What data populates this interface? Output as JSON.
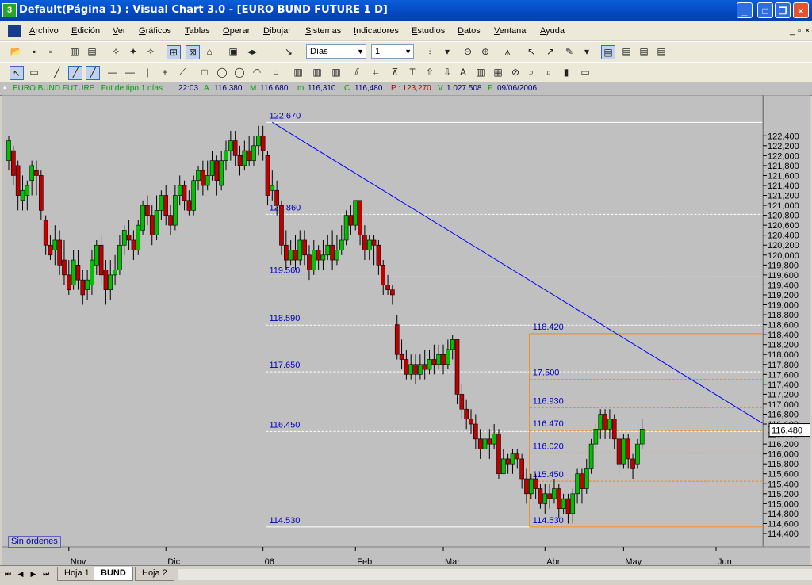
{
  "window": {
    "title": "Default(Página 1) : Visual Chart  3.0 - [EURO BUND FUTURE 1 D]",
    "app_icon": "3",
    "minimize": "_",
    "maximize": "□",
    "close": "×"
  },
  "menu": {
    "items": [
      "Archivo",
      "Edición",
      "Ver",
      "Gráficos",
      "Tablas",
      "Operar",
      "Dibujar",
      "Sistemas",
      "Indicadores",
      "Estudios",
      "Datos",
      "Ventana",
      "Ayuda"
    ],
    "mdi_controls": [
      "_",
      "▫",
      "×"
    ]
  },
  "toolbar": {
    "period_select": "Días",
    "interval_select": "1"
  },
  "infobar": {
    "symbol": "EURO BUND FUTURE : Fut de tipo 1 días",
    "time": "22:03",
    "open_label": "A",
    "open": "116,380",
    "high_label": "M",
    "high": "116,680",
    "low_label": "m",
    "low": "116,310",
    "close_label": "C",
    "close": "116,480",
    "change_label": "P",
    "change": ": 123,270",
    "volume_label": "V",
    "volume": "1.027.508",
    "date_label": "F",
    "date": "09/06/2006"
  },
  "status": {
    "orders": "Sin órdenes"
  },
  "tabs": [
    "Hoja 1",
    "BUND",
    "Hoja 2"
  ],
  "active_tab": "BUND",
  "colors": {
    "chart_bg": "#c0c0c0",
    "up": "#00c000",
    "down": "#c00000",
    "trendline": "#0000ff",
    "fib_left": "#ffffff",
    "fib_right": "#ff8000",
    "label_text": "#0000c0"
  },
  "chart_data": {
    "type": "candlestick",
    "ylim": [
      114.4,
      122.5
    ],
    "y_ticks": [
      "122,400",
      "122,200",
      "122,000",
      "121,800",
      "121,600",
      "121,400",
      "121,200",
      "121,000",
      "120,800",
      "120,600",
      "120,400",
      "120,200",
      "120,000",
      "119,800",
      "119,600",
      "119,400",
      "119,200",
      "119,000",
      "118,800",
      "118,600",
      "118,400",
      "118,200",
      "118,000",
      "117,800",
      "117,600",
      "117,400",
      "117,200",
      "117,000",
      "116,800",
      "116,600",
      "116,400",
      "116,200",
      "116,000",
      "115,800",
      "115,600",
      "115,400",
      "115,200",
      "115,000",
      "114,800",
      "114,600",
      "114,400"
    ],
    "x_labels": [
      {
        "label": "Nov",
        "index": 13
      },
      {
        "label": "Dic",
        "index": 34
      },
      {
        "label": "06",
        "index": 55
      },
      {
        "label": "Feb",
        "index": 75
      },
      {
        "label": "Mar",
        "index": 94
      },
      {
        "label": "Abr",
        "index": 116
      },
      {
        "label": "May",
        "index": 133
      },
      {
        "label": "Jun",
        "index": 153
      }
    ],
    "last_price": "116,480",
    "last_value": 116.48,
    "candles": [
      [
        121.9,
        122.3,
        122.4,
        121.7
      ],
      [
        122.1,
        121.6,
        122.2,
        121.4
      ],
      [
        121.8,
        121.2,
        121.9,
        120.9
      ],
      [
        121.1,
        121.3,
        121.6,
        120.9
      ],
      [
        121.2,
        121.4,
        121.5,
        120.9
      ],
      [
        121.5,
        121.8,
        121.9,
        121.2
      ],
      [
        121.7,
        121.6,
        121.9,
        121.2
      ],
      [
        121.6,
        120.9,
        121.7,
        120.7
      ],
      [
        120.7,
        120.2,
        120.8,
        120.0
      ],
      [
        120.2,
        120.0,
        120.4,
        119.9
      ],
      [
        120.1,
        120.3,
        120.6,
        119.8
      ],
      [
        120.3,
        119.8,
        120.5,
        119.6
      ],
      [
        119.9,
        119.6,
        120.3,
        119.4
      ],
      [
        119.6,
        119.3,
        119.9,
        119.2
      ],
      [
        119.4,
        119.9,
        120.1,
        119.3
      ],
      [
        119.8,
        119.5,
        120.1,
        119.3
      ],
      [
        119.5,
        119.2,
        119.7,
        119.0
      ],
      [
        119.3,
        119.5,
        119.7,
        119.1
      ],
      [
        119.4,
        119.9,
        120.1,
        119.2
      ],
      [
        119.8,
        120.2,
        120.3,
        119.6
      ],
      [
        120.2,
        119.6,
        120.4,
        119.4
      ],
      [
        119.7,
        119.3,
        119.9,
        119.0
      ],
      [
        119.3,
        119.6,
        119.9,
        119.1
      ],
      [
        119.6,
        119.7,
        120.0,
        119.4
      ],
      [
        119.7,
        120.2,
        120.4,
        119.6
      ],
      [
        120.2,
        120.5,
        120.6,
        120.0
      ],
      [
        120.4,
        120.3,
        120.7,
        120.1
      ],
      [
        120.3,
        120.1,
        120.5,
        119.9
      ],
      [
        120.1,
        120.6,
        120.7,
        120.0
      ],
      [
        120.5,
        121.0,
        121.1,
        120.4
      ],
      [
        121.0,
        120.8,
        121.2,
        120.6
      ],
      [
        120.8,
        120.4,
        121.0,
        120.2
      ],
      [
        120.4,
        120.9,
        121.2,
        120.3
      ],
      [
        120.9,
        121.2,
        121.3,
        120.7
      ],
      [
        121.2,
        120.8,
        121.4,
        120.6
      ],
      [
        120.8,
        120.6,
        121.0,
        120.4
      ],
      [
        120.6,
        121.2,
        121.4,
        120.5
      ],
      [
        121.2,
        121.4,
        121.6,
        121.0
      ],
      [
        121.4,
        121.1,
        121.5,
        120.9
      ],
      [
        121.1,
        120.9,
        121.3,
        120.8
      ],
      [
        120.9,
        121.5,
        121.6,
        120.8
      ],
      [
        121.5,
        121.7,
        121.8,
        121.3
      ],
      [
        121.7,
        121.4,
        121.9,
        121.2
      ],
      [
        121.4,
        121.6,
        121.9,
        121.3
      ],
      [
        121.6,
        121.9,
        122.1,
        121.5
      ],
      [
        121.9,
        121.5,
        122.0,
        121.2
      ],
      [
        121.4,
        121.9,
        122.1,
        121.3
      ],
      [
        121.9,
        122.1,
        122.3,
        121.7
      ],
      [
        122.1,
        122.3,
        122.5,
        121.9
      ],
      [
        122.3,
        122.0,
        122.5,
        121.8
      ],
      [
        122.0,
        121.8,
        122.2,
        121.6
      ],
      [
        121.8,
        122.1,
        122.3,
        121.7
      ],
      [
        122.1,
        121.9,
        122.4,
        121.8
      ],
      [
        121.9,
        122.2,
        122.4,
        121.8
      ],
      [
        122.2,
        122.4,
        122.6,
        122.0
      ],
      [
        122.4,
        122.1,
        122.6,
        121.9
      ],
      [
        122.0,
        121.2,
        122.1,
        121.0
      ],
      [
        121.3,
        121.4,
        121.7,
        121.1
      ],
      [
        121.3,
        121.0,
        121.5,
        120.8
      ],
      [
        121.0,
        120.2,
        121.1,
        120.0
      ],
      [
        120.2,
        119.9,
        120.5,
        119.7
      ],
      [
        119.9,
        120.1,
        120.3,
        119.8
      ],
      [
        120.1,
        119.9,
        120.4,
        119.7
      ],
      [
        119.9,
        120.3,
        120.5,
        119.8
      ],
      [
        120.3,
        120.0,
        120.5,
        119.8
      ],
      [
        120.0,
        119.7,
        120.2,
        119.5
      ],
      [
        119.7,
        120.1,
        120.3,
        119.6
      ],
      [
        120.1,
        119.9,
        120.2,
        119.7
      ],
      [
        119.9,
        120.0,
        120.3,
        119.7
      ],
      [
        120.0,
        120.2,
        120.4,
        119.9
      ],
      [
        120.2,
        119.9,
        120.5,
        119.7
      ],
      [
        119.9,
        120.1,
        120.4,
        119.8
      ],
      [
        120.1,
        120.3,
        120.6,
        120.0
      ],
      [
        120.3,
        120.8,
        120.9,
        120.2
      ],
      [
        120.8,
        120.6,
        121.0,
        120.4
      ],
      [
        120.6,
        121.1,
        121.1,
        120.5
      ],
      [
        121.1,
        120.4,
        121.1,
        120.2
      ],
      [
        120.4,
        120.1,
        120.6,
        119.9
      ],
      [
        120.1,
        120.3,
        120.4,
        119.9
      ],
      [
        120.3,
        120.2,
        120.4,
        119.8
      ],
      [
        120.2,
        119.8,
        120.3,
        119.6
      ],
      [
        119.8,
        119.4,
        119.9,
        119.2
      ],
      [
        119.4,
        119.3,
        119.6,
        119.2
      ],
      [
        119.3,
        119.2,
        119.4,
        119.0
      ],
      [
        118.6,
        118.0,
        118.8,
        117.9
      ],
      [
        118.0,
        117.9,
        118.3,
        117.7
      ],
      [
        117.9,
        117.6,
        118.1,
        117.5
      ],
      [
        117.6,
        117.8,
        118.0,
        117.5
      ],
      [
        117.8,
        117.6,
        118.0,
        117.4
      ],
      [
        117.6,
        117.8,
        118.0,
        117.5
      ],
      [
        117.8,
        117.7,
        118.1,
        117.5
      ],
      [
        117.7,
        117.9,
        118.1,
        117.6
      ],
      [
        117.9,
        117.8,
        118.2,
        117.6
      ],
      [
        117.8,
        118.0,
        118.2,
        117.7
      ],
      [
        118.0,
        117.8,
        118.2,
        117.6
      ],
      [
        117.8,
        118.1,
        118.3,
        117.7
      ],
      [
        118.1,
        118.3,
        118.4,
        117.9
      ],
      [
        118.3,
        117.2,
        118.3,
        117.0
      ],
      [
        117.2,
        116.9,
        117.4,
        116.7
      ],
      [
        116.9,
        116.7,
        117.1,
        116.5
      ],
      [
        116.7,
        116.6,
        116.9,
        116.4
      ],
      [
        116.6,
        116.3,
        116.8,
        116.1
      ],
      [
        116.3,
        116.1,
        116.5,
        115.9
      ],
      [
        116.1,
        116.3,
        116.5,
        116.0
      ],
      [
        116.3,
        116.2,
        116.5,
        115.9
      ],
      [
        116.2,
        116.4,
        116.6,
        116.1
      ],
      [
        116.4,
        115.6,
        116.5,
        115.5
      ],
      [
        115.6,
        115.9,
        116.1,
        115.6
      ],
      [
        115.9,
        115.8,
        116.0,
        115.6
      ],
      [
        115.8,
        116.0,
        116.1,
        115.6
      ],
      [
        116.0,
        115.9,
        116.1,
        115.7
      ],
      [
        115.9,
        115.5,
        116.0,
        115.3
      ],
      [
        115.5,
        115.2,
        115.7,
        115.0
      ],
      [
        115.2,
        115.5,
        115.6,
        115.1
      ],
      [
        115.5,
        115.3,
        115.6,
        115.1
      ],
      [
        115.3,
        115.0,
        115.4,
        114.9
      ],
      [
        115.0,
        115.2,
        115.4,
        114.8
      ],
      [
        115.2,
        115.1,
        115.4,
        114.9
      ],
      [
        115.1,
        115.3,
        115.5,
        115.0
      ],
      [
        115.3,
        114.9,
        115.4,
        114.7
      ],
      [
        114.9,
        115.1,
        115.2,
        114.8
      ],
      [
        115.1,
        114.8,
        115.2,
        114.6
      ],
      [
        114.8,
        115.2,
        115.3,
        114.6
      ],
      [
        115.2,
        115.6,
        115.7,
        115.0
      ],
      [
        115.6,
        115.3,
        115.7,
        115.0
      ],
      [
        115.3,
        115.7,
        115.9,
        115.2
      ],
      [
        115.7,
        116.2,
        116.3,
        115.6
      ],
      [
        116.2,
        116.5,
        116.6,
        116.1
      ],
      [
        116.5,
        116.8,
        116.9,
        116.3
      ],
      [
        116.8,
        116.5,
        116.9,
        116.3
      ],
      [
        116.5,
        116.7,
        116.9,
        116.3
      ],
      [
        116.7,
        116.3,
        116.8,
        116.1
      ],
      [
        116.3,
        115.8,
        116.4,
        115.6
      ],
      [
        115.8,
        116.3,
        116.4,
        115.7
      ],
      [
        116.3,
        115.9,
        116.4,
        115.7
      ],
      [
        115.9,
        115.7,
        116.0,
        115.5
      ],
      [
        115.8,
        116.2,
        116.3,
        115.7
      ],
      [
        116.2,
        116.5,
        116.7,
        116.1
      ]
    ],
    "trendline": {
      "from_index": 57,
      "from_value": 122.67,
      "to_index": 163,
      "to_value": 116.62
    },
    "fib_left": {
      "start_index": 56,
      "end_index": 163,
      "levels": [
        {
          "value": 122.67,
          "label": "122.670"
        },
        {
          "value": 120.82,
          "label": "120.860"
        },
        {
          "value": 119.56,
          "label": "119.560"
        },
        {
          "value": 118.59,
          "label": "118.590"
        },
        {
          "value": 117.65,
          "label": "117.650"
        },
        {
          "value": 116.45,
          "label": "116.450"
        },
        {
          "value": 114.53,
          "label": "114.530"
        }
      ]
    },
    "fib_right": {
      "start_index": 113,
      "end_index": 163,
      "levels": [
        {
          "value": 118.42,
          "label": "118.420"
        },
        {
          "value": 117.5,
          "label": "17.500"
        },
        {
          "value": 116.93,
          "label": "116.930"
        },
        {
          "value": 116.47,
          "label": "116.470"
        },
        {
          "value": 116.02,
          "label": "116.020"
        },
        {
          "value": 115.45,
          "label": "115.450"
        },
        {
          "value": 114.53,
          "label": "114.530"
        }
      ]
    }
  }
}
